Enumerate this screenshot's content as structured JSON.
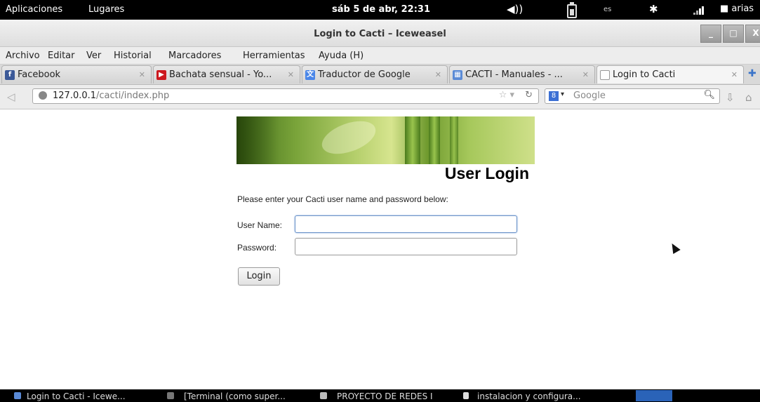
{
  "top_panel": {
    "applications": "Aplicaciones",
    "places": "Lugares",
    "clock": "sáb  5 de abr, 22:31",
    "volume_icon": "◀))",
    "lang": "es",
    "bluetooth_icon": "✱",
    "user": "arias"
  },
  "window": {
    "title": "Login to Cacti – Iceweasel",
    "minimize": "_",
    "maximize": "□",
    "close": "X"
  },
  "menu": {
    "items": [
      "Archivo",
      "Editar",
      "Ver",
      "Historial",
      "Marcadores",
      "Herramientas",
      "Ayuda (H)"
    ]
  },
  "tabs": [
    {
      "label": "Facebook",
      "icon": "facebook-icon",
      "color": "#3b5998",
      "glyph": "f"
    },
    {
      "label": "Bachata sensual - Yo...",
      "icon": "youtube-icon",
      "color": "#cc181e",
      "glyph": "▶"
    },
    {
      "label": "Traductor de Google",
      "icon": "translate-icon",
      "color": "#4a86e8",
      "glyph": "文"
    },
    {
      "label": "CACTI - Manuales - ...",
      "icon": "cacti-icon",
      "color": "#5b8bd6",
      "glyph": "▦"
    },
    {
      "label": "Login to Cacti",
      "icon": "blank-page-icon",
      "color": "#ffffff",
      "glyph": ""
    }
  ],
  "nav": {
    "url_host": "127.0.0.1",
    "url_path": "/cacti/index.php",
    "search_placeholder": "Google",
    "search_engine_glyph": "8"
  },
  "page": {
    "heading": "User Login",
    "instructions": "Please enter your Cacti user name and password below:",
    "username_label": "User Name:",
    "username_value": "",
    "password_label": "Password:",
    "password_value": "",
    "login_button": "Login"
  },
  "taskbar": {
    "items": [
      "Login to Cacti - Icewe...",
      "[Terminal (como super...",
      "PROYECTO DE REDES I",
      "instalacion y configura..."
    ]
  },
  "colors": {
    "panel": "#000000",
    "accent": "#3b6fd4"
  }
}
